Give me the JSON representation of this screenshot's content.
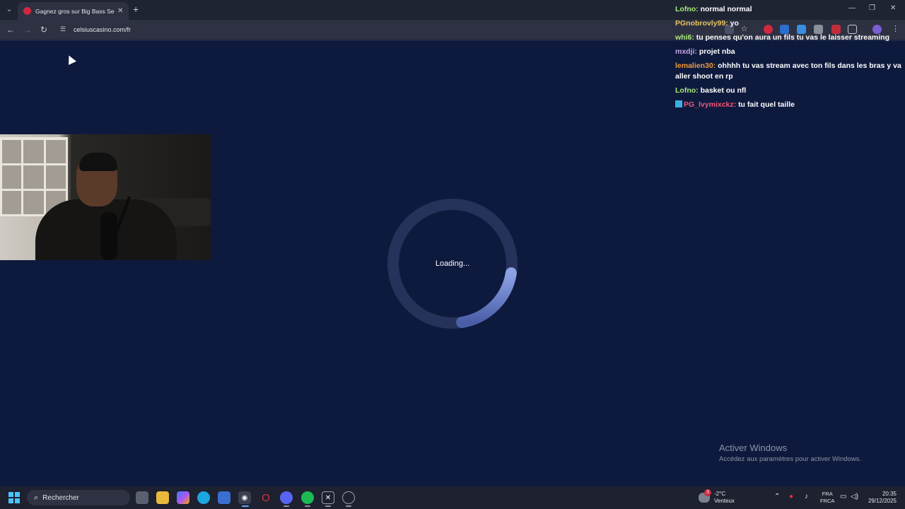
{
  "browser": {
    "tab_title": "Gagnez gros sur Big Bass Secre",
    "url": "celsiuscasino.com/fr",
    "new_tab_label": "+",
    "tab_close_label": "✕"
  },
  "page": {
    "loading_text": "Loading...",
    "loader_color": "#7b8fd4",
    "background_color": "#0e1a3d",
    "loader_progress": 0.2
  },
  "chat": [
    {
      "user": "Lofno:",
      "message": "normal normal",
      "color": "#a8e87a"
    },
    {
      "user": "PGnobrovly99:",
      "message": "yo",
      "color": "#e8c45a"
    },
    {
      "user": "whi6:",
      "message": "tu penses qu'on aura un fils tu vas le laisser streaming",
      "color": "#a8e87a"
    },
    {
      "user": "mxdji:",
      "message": "projet nba",
      "color": "#c5a3e8"
    },
    {
      "user": "lemalien30:",
      "message": "ohhhh tu vas stream avec ton fils dans les bras y va aller shoot en rp",
      "color": "#f09a3a"
    },
    {
      "user": "Lofno:",
      "message": "basket ou nfl",
      "color": "#a8e87a"
    },
    {
      "user": "PG_lvymixckz:",
      "message": "tu fait quel taille",
      "color": "#f0567a"
    }
  ],
  "watermark": {
    "title": "Activer Windows",
    "subtitle": "Accédez aux paramètres pour activer Windows."
  },
  "taskbar": {
    "search_label": "Rechercher",
    "weather_temp": "-2°C",
    "weather_desc": "Venteux",
    "weather_badge": "3",
    "lang_line1": "FRA",
    "lang_line2": "FRCA",
    "time": "20:35",
    "date": "29/12/2025"
  },
  "icons": {
    "back": "back-arrow-icon",
    "forward": "forward-arrow-icon",
    "reload": "reload-icon",
    "site_info": "site-info-icon",
    "star": "bookmark-star-icon"
  }
}
